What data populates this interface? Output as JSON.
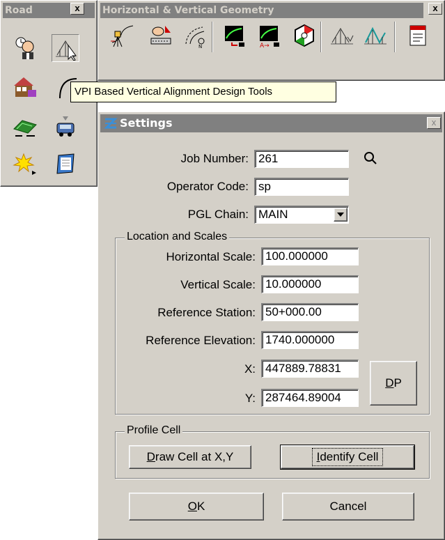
{
  "road_palette": {
    "title": "Road",
    "close_label": "x",
    "tools": [
      "surveyor-icon",
      "vertical-alignment-icon",
      "earthwork-icon",
      "curve-icon",
      "terrain-icon",
      "vehicle-icon",
      "burst-icon",
      "notebook-icon"
    ]
  },
  "geometry_toolbar": {
    "title": "Horizontal & Vertical Geometry",
    "close_label": "x"
  },
  "tooltip": {
    "text": "VPI Based Vertical Alignment Design Tools"
  },
  "settings": {
    "title": "Settings",
    "close_label": "x",
    "job_number": {
      "label": "Job Number:",
      "value": "261"
    },
    "operator_code": {
      "label": "Operator Code:",
      "value": "sp"
    },
    "pgl_chain": {
      "label": "PGL Chain:",
      "value": "MAIN"
    },
    "location_group": {
      "label": "Location and Scales",
      "horizontal_scale": {
        "label": "Horizontal Scale:",
        "value": "100.000000"
      },
      "vertical_scale": {
        "label": "Vertical Scale:",
        "value": "10.000000"
      },
      "reference_station": {
        "label": "Reference Station:",
        "value": "50+000.00"
      },
      "reference_elevation": {
        "label": "Reference Elevation:",
        "value": "1740.000000"
      },
      "x": {
        "label": "X:",
        "value": "447889.78831"
      },
      "y": {
        "label": "Y:",
        "value": "287464.89004"
      },
      "dp_button": {
        "mnemonic": "D",
        "rest": "P"
      }
    },
    "profile_group": {
      "label": "Profile Cell",
      "draw_button": {
        "mnemonic": "D",
        "rest": "raw Cell at X,Y"
      },
      "identify_button": {
        "mnemonic": "I",
        "rest": "dentify Cell"
      }
    },
    "ok_button": {
      "mnemonic": "O",
      "rest": "K"
    },
    "cancel_button": {
      "label": "Cancel"
    }
  }
}
